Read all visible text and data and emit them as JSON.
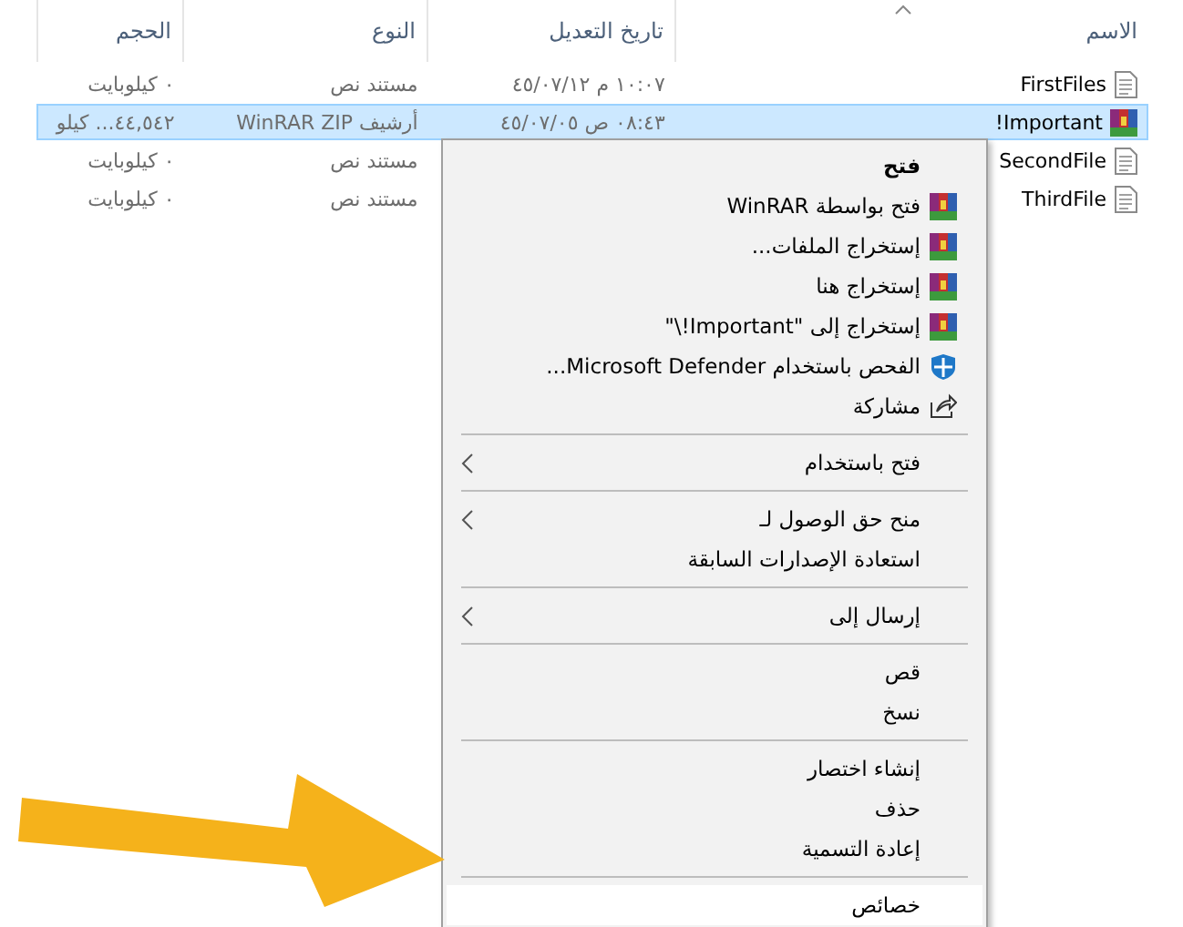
{
  "columns": [
    {
      "label": "الاسم",
      "kind": "name",
      "sorted": true
    },
    {
      "label": "تاريخ التعديل",
      "kind": "date"
    },
    {
      "label": "النوع",
      "kind": "type"
    },
    {
      "label": "الحجم",
      "kind": "size"
    }
  ],
  "files": [
    {
      "name": "FirstFiles",
      "kind": "text",
      "date": "١٠:٠٧ م ٤٥/٠٧/١٢",
      "type": "مستند نص",
      "size": "٠ كيلوبايت",
      "selected": false
    },
    {
      "name": "Important!",
      "kind": "archive",
      "date": "٠٨:٤٣ ص ٤٥/٠٧/٠٥",
      "type": "أرشيف WinRAR ZIP",
      "size": "٤٤,٥٤٢... كيلو",
      "selected": true
    },
    {
      "name": "SecondFile",
      "kind": "text",
      "type": "مستند نص",
      "size": "٠ كيلوبايت",
      "selected": false
    },
    {
      "name": "ThirdFile",
      "kind": "text",
      "type": "مستند نص",
      "size": "٠ كيلوبايت",
      "selected": false
    }
  ],
  "context_menu": {
    "items": [
      {
        "kind": "plain",
        "label": "فتح",
        "bold": true
      },
      {
        "kind": "archive",
        "label": "فتح بواسطة WinRAR"
      },
      {
        "kind": "archive",
        "label": "إستخراج الملفات..."
      },
      {
        "kind": "archive",
        "label": "إستخراج هنا"
      },
      {
        "kind": "archive",
        "label": "إستخراج إلى \"Important!\\\""
      },
      {
        "kind": "shield",
        "label": "الفحص باستخدام Microsoft Defender..."
      },
      {
        "kind": "share",
        "label": "مشاركة"
      },
      {
        "kind": "separator"
      },
      {
        "kind": "plain",
        "label": "فتح باستخدام",
        "submenu": true
      },
      {
        "kind": "separator"
      },
      {
        "kind": "plain",
        "label": "منح حق الوصول لـ",
        "submenu": true
      },
      {
        "kind": "plain",
        "label": "استعادة الإصدارات السابقة"
      },
      {
        "kind": "separator"
      },
      {
        "kind": "plain",
        "label": "إرسال إلى",
        "submenu": true
      },
      {
        "kind": "separator"
      },
      {
        "kind": "plain",
        "label": "قص"
      },
      {
        "kind": "plain",
        "label": "نسخ"
      },
      {
        "kind": "separator"
      },
      {
        "kind": "plain",
        "label": "إنشاء اختصار"
      },
      {
        "kind": "plain",
        "label": "حذف"
      },
      {
        "kind": "plain",
        "label": "إعادة التسمية"
      },
      {
        "kind": "separator"
      },
      {
        "kind": "plain",
        "label": "خصائص",
        "highlighted": true
      }
    ]
  }
}
